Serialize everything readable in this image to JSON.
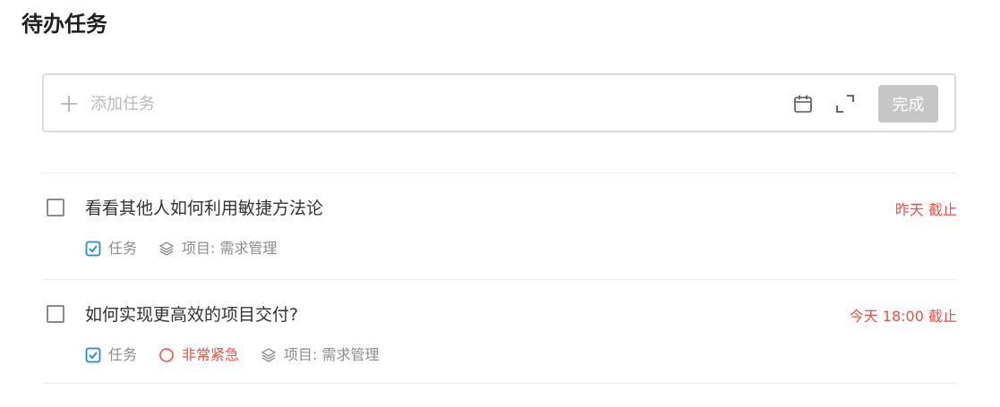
{
  "page": {
    "title": "待办任务"
  },
  "add_bar": {
    "placeholder": "添加任务",
    "done_label": "完成"
  },
  "tasks": [
    {
      "title": "看看其他人如何利用敏捷方法论",
      "deadline": "昨天 截止",
      "type": "任务",
      "project": "项目: 需求管理"
    },
    {
      "title": "如何实现更高效的项目交付?",
      "deadline": "今天 18:00 截止",
      "type": "任务",
      "priority": "非常紧急",
      "project": "项目: 需求管理"
    }
  ],
  "colors": {
    "accent_blue": "#1e88e5",
    "urgent_red": "#f5503c",
    "muted_text": "#8c8c8c",
    "disabled_button": "#c6c6c6"
  },
  "icons": {
    "add": "plus-icon",
    "date": "calendar-icon",
    "fullscreen": "expand-icon",
    "task_type": "task-type-icon",
    "priority": "priority-circle-icon",
    "project": "layers-icon"
  }
}
